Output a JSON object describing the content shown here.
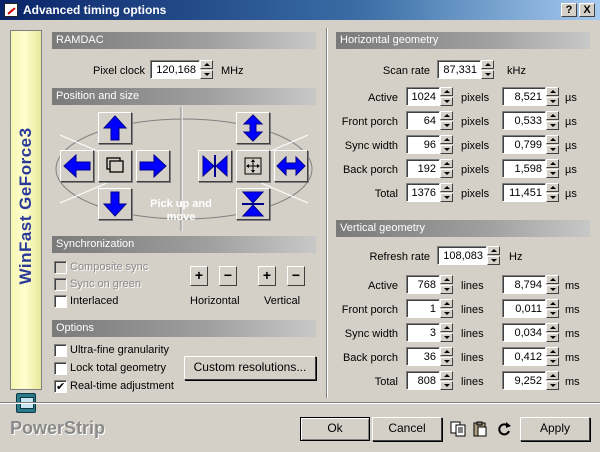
{
  "window": {
    "title": "Advanced timing options",
    "help_label": "?",
    "close_label": "X"
  },
  "brand": {
    "vendor_text": "WinFast GeForce3",
    "product_text": "PowerStrip"
  },
  "ramdac": {
    "header": "RAMDAC",
    "pixel_clock_label": "Pixel clock",
    "pixel_clock_value": "120,168",
    "pixel_clock_unit": "MHz"
  },
  "position": {
    "header": "Position and size",
    "pickup_label": "Pick up and move"
  },
  "sync": {
    "header": "Synchronization",
    "composite_label": "Composite sync",
    "green_label": "Sync on green",
    "interlaced_label": "Interlaced",
    "horizontal_label": "Horizontal",
    "vertical_label": "Vertical",
    "plus": "+",
    "minus": "−"
  },
  "options": {
    "header": "Options",
    "ultrafine_label": "Ultra-fine granularity",
    "lock_label": "Lock total geometry",
    "realtime_label": "Real-time adjustment",
    "realtime_checked": "✔",
    "custom_button": "Custom resolutions..."
  },
  "hgeo": {
    "header": "Horizontal geometry",
    "scan_label": "Scan rate",
    "scan_value": "87,331",
    "scan_unit": "kHz",
    "unit_main": "pixels",
    "unit_time": "µs",
    "rows": [
      {
        "label": "Active",
        "value": "1024",
        "time": "8,521"
      },
      {
        "label": "Front porch",
        "value": "64",
        "time": "0,533"
      },
      {
        "label": "Sync width",
        "value": "96",
        "time": "0,799"
      },
      {
        "label": "Back porch",
        "value": "192",
        "time": "1,598"
      },
      {
        "label": "Total",
        "value": "1376",
        "time": "11,451"
      }
    ]
  },
  "vgeo": {
    "header": "Vertical geometry",
    "refresh_label": "Refresh rate",
    "refresh_value": "108,083",
    "refresh_unit": "Hz",
    "unit_main": "lines",
    "unit_time": "ms",
    "rows": [
      {
        "label": "Active",
        "value": "768",
        "time": "8,794"
      },
      {
        "label": "Front porch",
        "value": "1",
        "time": "0,011"
      },
      {
        "label": "Sync width",
        "value": "3",
        "time": "0,034"
      },
      {
        "label": "Back porch",
        "value": "36",
        "time": "0,412"
      },
      {
        "label": "Total",
        "value": "808",
        "time": "9,252"
      }
    ]
  },
  "footer": {
    "ok_label": "Ok",
    "cancel_label": "Cancel",
    "apply_label": "Apply"
  }
}
